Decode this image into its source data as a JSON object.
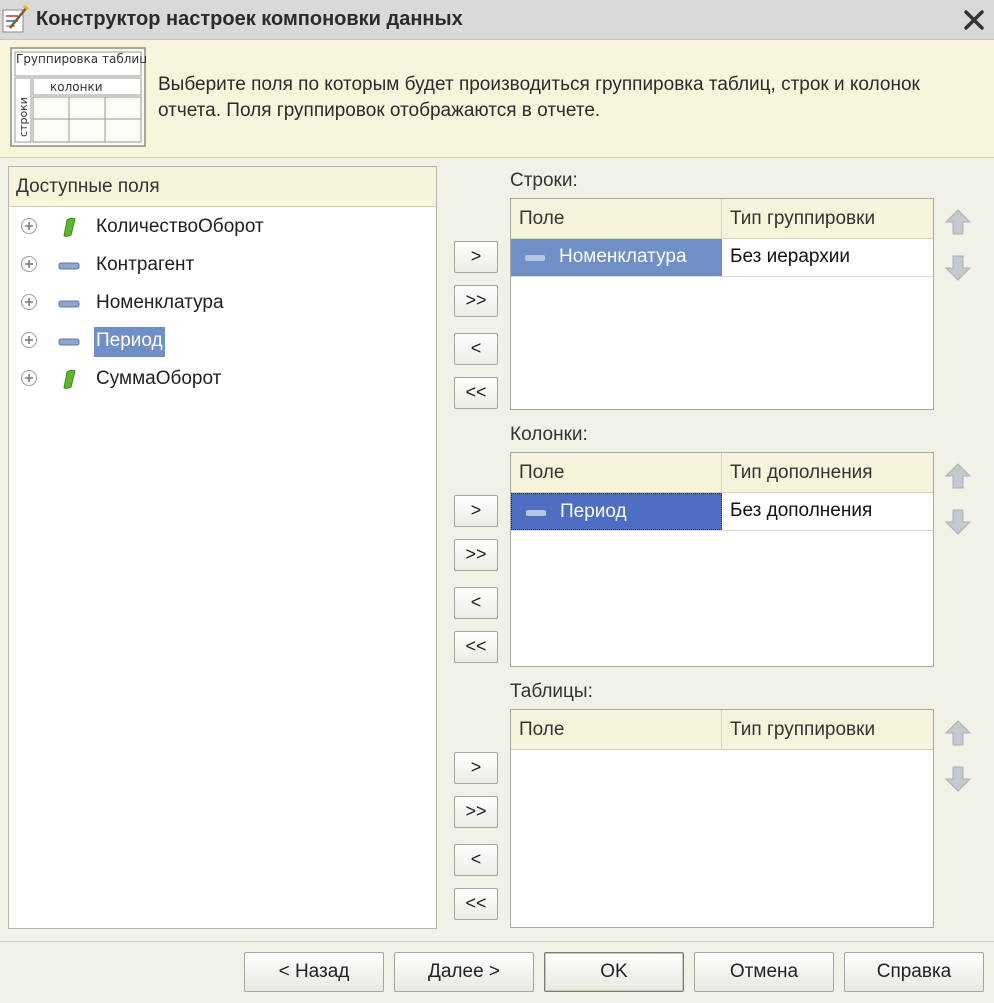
{
  "window": {
    "title": "Конструктор настроек компоновки данных",
    "close_icon": "close-icon"
  },
  "header": {
    "description": "Выберите поля по которым будет производиться группировка таблиц, строк и колонок отчета. Поля группировок отображаются в отчете.",
    "picture": {
      "tables_label": "Группировка таблиц",
      "columns_label": "колонки",
      "rows_label": "строки"
    }
  },
  "available_fields": {
    "title": "Доступные поля",
    "items": [
      {
        "label": "КоличествоОборот",
        "icon": "resource-icon"
      },
      {
        "label": "Контрагент",
        "icon": "dimension-icon"
      },
      {
        "label": "Номенклатура",
        "icon": "dimension-icon"
      },
      {
        "label": "Период",
        "icon": "dimension-icon",
        "selected": true
      },
      {
        "label": "СуммаОборот",
        "icon": "resource-icon"
      }
    ]
  },
  "transfer_buttons": {
    "add": ">",
    "add_all": ">>",
    "remove": "<",
    "remove_all": "<<"
  },
  "rows": {
    "label": "Строки:",
    "columns": [
      "Поле",
      "Тип группировки"
    ],
    "items": [
      {
        "field": "Номенклатура",
        "type": "Без иерархии"
      }
    ]
  },
  "columns_section": {
    "label": "Колонки:",
    "columns": [
      "Поле",
      "Тип дополнения"
    ],
    "items": [
      {
        "field": "Период",
        "type": "Без дополнения"
      }
    ]
  },
  "tables": {
    "label": "Таблицы:",
    "columns": [
      "Поле",
      "Тип группировки"
    ],
    "items": []
  },
  "footer": {
    "back": "< Назад",
    "next": "Далее >",
    "ok": "OK",
    "cancel": "Отмена",
    "help": "Справка"
  },
  "colors": {
    "selection": "#6f8fc6",
    "selection_focused": "#4e6ec2",
    "header_bg": "#f7f6dc",
    "resource_green": "#5cb82a"
  }
}
